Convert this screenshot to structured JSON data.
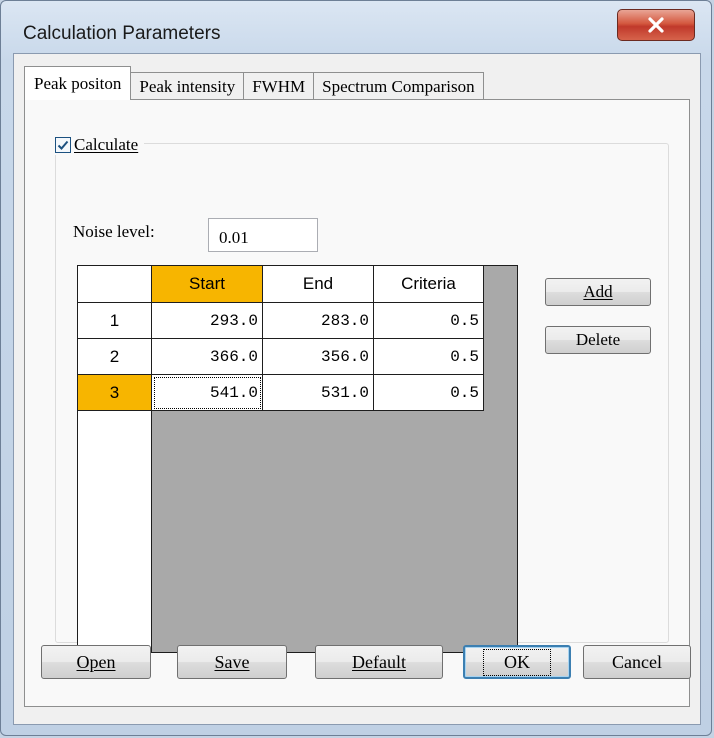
{
  "window": {
    "title": "Calculation Parameters",
    "close_glyph": "✕"
  },
  "tabs": [
    {
      "label": "Peak positon",
      "active": true
    },
    {
      "label": "Peak intensity",
      "active": false
    },
    {
      "label": "FWHM",
      "active": false
    },
    {
      "label": "Spectrum Comparison",
      "active": false
    }
  ],
  "calculate": {
    "label": "Calculate",
    "checked": true
  },
  "noise": {
    "label": "Noise level:",
    "value": "0.01"
  },
  "table": {
    "columns": [
      "Start",
      "End",
      "Criteria"
    ],
    "rows": [
      {
        "index": "1",
        "start": "293.0",
        "end": "283.0",
        "criteria": "0.5"
      },
      {
        "index": "2",
        "start": "366.0",
        "end": "356.0",
        "criteria": "0.5"
      },
      {
        "index": "3",
        "start": "541.0",
        "end": "531.0",
        "criteria": "0.5"
      }
    ],
    "selected_row": "3",
    "selected_column": "Start"
  },
  "side_buttons": {
    "add": "Add",
    "delete": "Delete"
  },
  "footer_buttons": {
    "open": "Open",
    "save": "Save",
    "default": "Default",
    "ok": "OK",
    "cancel": "Cancel"
  },
  "colors": {
    "selection": "#f7b500",
    "close_button": "#c0392b",
    "checkbox_accent": "#1c5180"
  },
  "icons": {
    "close": "close-icon",
    "check": "checkmark-icon"
  }
}
